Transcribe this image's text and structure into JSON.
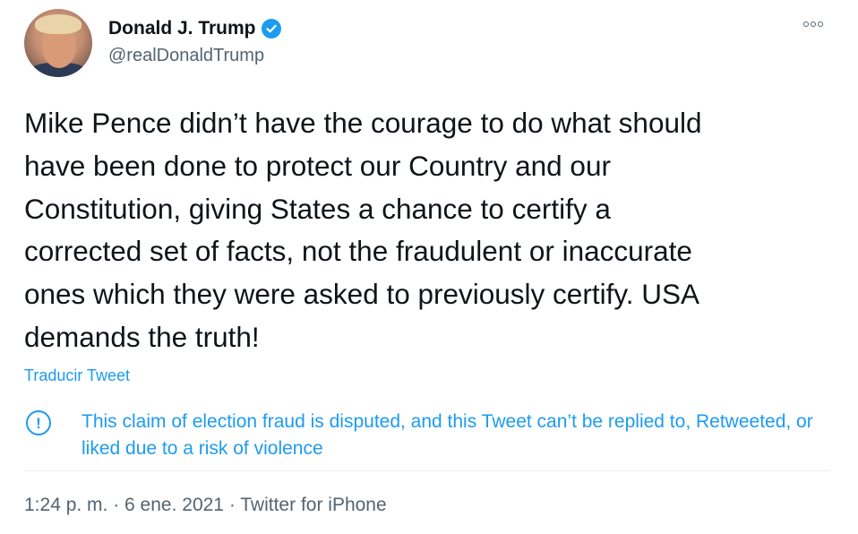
{
  "tweet": {
    "author": {
      "name": "Donald J. Trump",
      "handle": "@realDonaldTrump",
      "verified": true
    },
    "text": "Mike Pence didn’t have the courage to do what should\nhave been done to protect our Country and our\nConstitution, giving States a chance to certify a\ncorrected set of facts, not the fraudulent or inaccurate\nones which they were asked to previously certify. USA\ndemands the truth!",
    "translate_label": "Traducir Tweet",
    "notice": {
      "icon": "!",
      "text": "This claim of election fraud is disputed, and this Tweet can’t be replied to, Retweeted, or liked due to a risk of violence"
    },
    "meta": "1:24 p. m. · 6 ene. 2021 · Twitter for iPhone"
  },
  "colors": {
    "accent": "#1d9bf0",
    "text": "#0f1419",
    "secondary": "#536471"
  }
}
